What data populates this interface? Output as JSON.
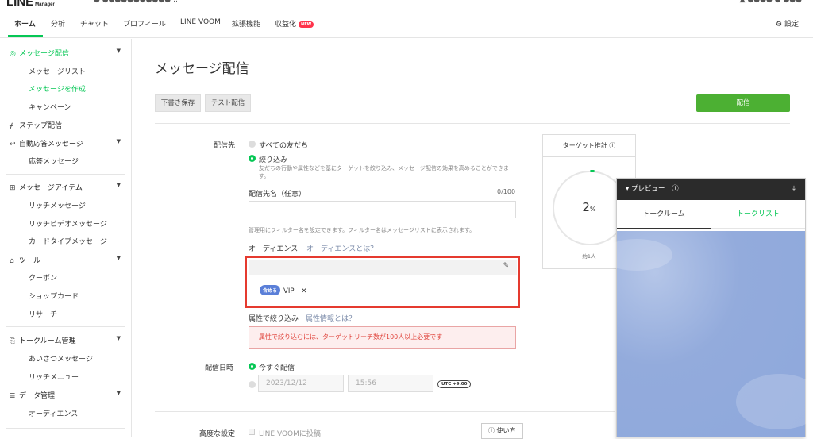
{
  "header": {
    "logo": "LINE",
    "logo_sub": "Manager",
    "account": "● ●●●●●●●●●●● …",
    "right_text": "▲  ●●●●  ●  ●●●"
  },
  "nav": {
    "items": [
      {
        "label": "ホーム"
      },
      {
        "label": "分析"
      },
      {
        "label": "チャット"
      },
      {
        "label": "プロフィール"
      },
      {
        "label": "LINE VOOM"
      },
      {
        "label": "拡張機能"
      },
      {
        "label": "収益化"
      }
    ],
    "new_badge": "NEW",
    "settings": "設定"
  },
  "sidebar": {
    "sections": [
      {
        "label": "メッセージ配信",
        "icon": "broadcast-icon"
      },
      {
        "label": "メッセージリスト"
      },
      {
        "label": "メッセージを作成"
      },
      {
        "label": "キャンペーン"
      },
      {
        "label": "ステップ配信",
        "icon": "step-icon"
      },
      {
        "label": "自動応答メッセージ",
        "icon": "reply-icon"
      },
      {
        "label": "応答メッセージ"
      },
      {
        "label": "メッセージアイテム",
        "icon": "plus-box-icon"
      },
      {
        "label": "リッチメッセージ"
      },
      {
        "label": "リッチビデオメッセージ"
      },
      {
        "label": "カードタイプメッセージ"
      },
      {
        "label": "ツール",
        "icon": "store-icon"
      },
      {
        "label": "クーポン"
      },
      {
        "label": "ショップカード"
      },
      {
        "label": "リサーチ"
      },
      {
        "label": "トークルーム管理",
        "icon": "talkroom-icon"
      },
      {
        "label": "あいさつメッセージ"
      },
      {
        "label": "リッチメニュー"
      },
      {
        "label": "データ管理",
        "icon": "database-icon"
      },
      {
        "label": "オーディエンス"
      }
    ]
  },
  "main": {
    "title": "メッセージ配信",
    "save_draft": "下書き保存",
    "test_send": "テスト配信",
    "send": "配信",
    "recipient_label": "配信先",
    "all_friends": "すべての友だち",
    "narrow": "絞り込み",
    "narrow_desc": "友だちの行動や属性などを基にターゲットを絞り込み、メッセージ配信の効果を高めることができます。",
    "dest_name_label": "配信先名（任意）",
    "dest_name_count": "0/100",
    "dest_name_value": "",
    "filter_note": "管理用にフィルター名を設定できます。フィルター名はメッセージリストに表示されます。",
    "audience_label": "オーディエンス",
    "audience_link": "オーディエンスとは？",
    "include_badge": "含める",
    "audience_item": "VIP",
    "remove": "✕",
    "attr_label": "属性で絞り込み",
    "attr_link": "属性情報とは？",
    "warning": "属性で絞り込むには、ターゲットリーチ数が100人以上必要です",
    "date_label": "配信日時",
    "send_now": "今すぐ配信",
    "date_value": "2023/12/12",
    "time_value": "15:56",
    "utc": "UTC +9:00",
    "advanced_label": "高度な設定",
    "voom_post": "LINE VOOMに投稿",
    "howto": "使い方"
  },
  "target": {
    "title": "ターゲット推計",
    "percent": "2",
    "percent_unit": "%",
    "approx": "約1人"
  },
  "preview": {
    "title": "プレビュー",
    "tab_talkroom": "トークルーム",
    "tab_talklist": "トークリスト"
  }
}
